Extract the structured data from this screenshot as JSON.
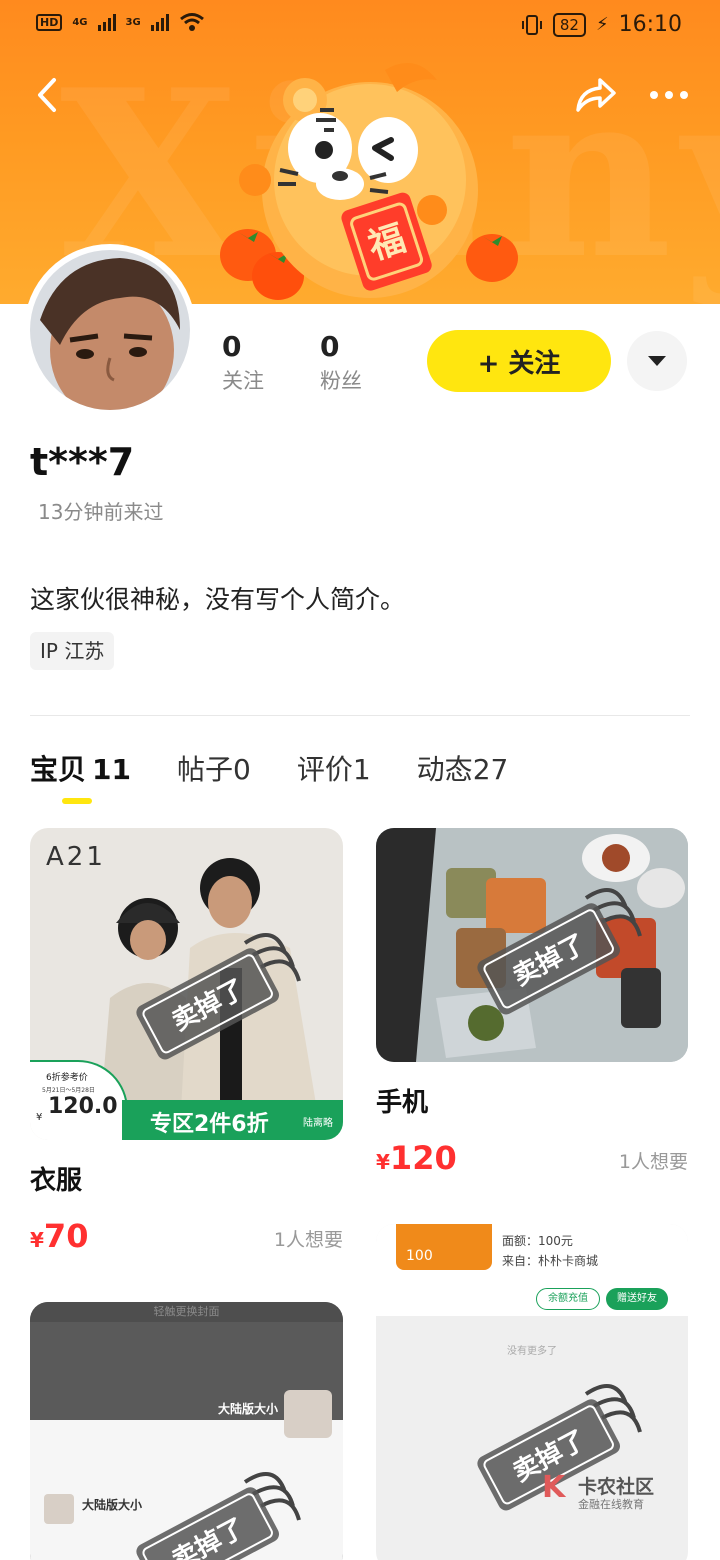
{
  "status_bar": {
    "left": "HD",
    "sig1": "4G",
    "sig2": "3G",
    "battery": "82",
    "time": "16:10"
  },
  "banner": {
    "bg_text": "Xianyu",
    "mascot_badge": "福"
  },
  "profile": {
    "following_count": "0",
    "following_label": "关注",
    "fans_count": "0",
    "fans_label": "粉丝",
    "follow_button": "+ 关注",
    "username": "t***7",
    "last_seen": "13分钟前来过",
    "bio": "这家伙很神秘，没有写个人简介。",
    "ip_tag": "IP 江苏"
  },
  "tabs": [
    {
      "label": "宝贝",
      "count": "11"
    },
    {
      "label": "帖子",
      "count": "0"
    },
    {
      "label": "评价",
      "count": "1"
    },
    {
      "label": "动态",
      "count": "27"
    }
  ],
  "sold_label": "卖掉了",
  "items": [
    {
      "title": "衣服",
      "price_symbol": "¥",
      "price": "70",
      "wants": "1人想要",
      "img_brand": "A21",
      "img_promo_tag": "6折参考价",
      "img_promo_dates": "5月21日～5月28日",
      "img_promo_price": "120.0",
      "img_promo_currency": "¥",
      "img_banner": "专区2件6折",
      "img_banner_small": "陆离略"
    },
    {
      "title": "手机",
      "price_symbol": "¥",
      "price": "120",
      "wants": "1人想要"
    },
    {
      "img_top_text": "轻触更换封面",
      "img_label1": "大陆版大小",
      "img_label2": "大陆版大小"
    },
    {
      "img_amount": "100",
      "img_line1": "面额：100元",
      "img_line2": "来自：朴朴卡商城",
      "img_btn1": "余额充值",
      "img_btn2": "赠送好友",
      "img_none": "没有更多了",
      "img_watermark": "卡农社区",
      "img_watermark_sub": "金融在线教育"
    }
  ],
  "colors": {
    "banner": "#ff9a22",
    "accent_yellow": "#ffe60f",
    "price_red": "#ff3030"
  }
}
